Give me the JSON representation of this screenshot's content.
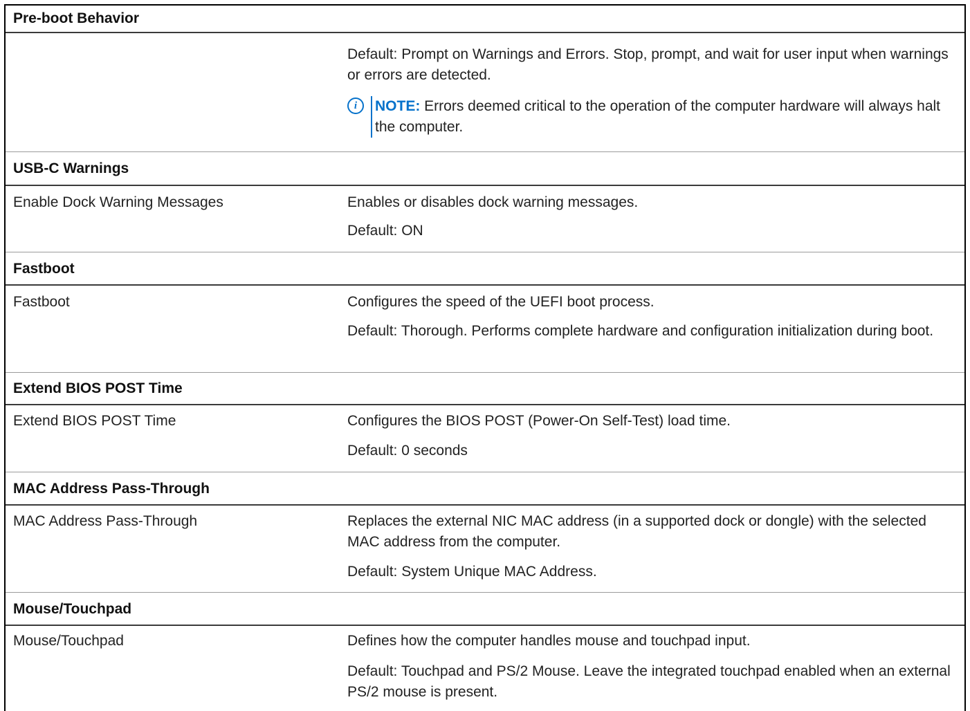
{
  "sections": [
    {
      "header": "Pre-boot Behavior",
      "description": "Default: Prompt on Warnings and Errors. Stop, prompt, and wait for user input when warnings or errors are detected.",
      "note_label": "NOTE:",
      "note_text": "Errors deemed critical to the operation of the computer hardware will always halt the computer."
    },
    {
      "header": "USB-C Warnings",
      "option": "Enable Dock Warning Messages",
      "description": "Enables or disables dock warning messages.",
      "default": "Default: ON"
    },
    {
      "header": "Fastboot",
      "option": "Fastboot",
      "description": "Configures the speed of the UEFI boot process.",
      "default": "Default: Thorough. Performs complete hardware and configuration initialization during boot."
    },
    {
      "header": "Extend BIOS POST Time",
      "option": "Extend BIOS POST Time",
      "description": "Configures the BIOS POST (Power-On Self-Test) load time.",
      "default": "Default: 0 seconds"
    },
    {
      "header": "MAC Address Pass-Through",
      "option": "MAC Address Pass-Through",
      "description": "Replaces the external NIC MAC address (in a supported dock or dongle) with the selected MAC address from the computer.",
      "default": "Default: System Unique MAC Address."
    },
    {
      "header": "Mouse/Touchpad",
      "option": "Mouse/Touchpad",
      "description": "Defines how the computer handles mouse and touchpad input.",
      "default": "Default: Touchpad and PS/2 Mouse. Leave the integrated touchpad enabled when an external PS/2 mouse is present."
    }
  ],
  "colors": {
    "note_accent": "#0672cb",
    "text": "#222222"
  }
}
